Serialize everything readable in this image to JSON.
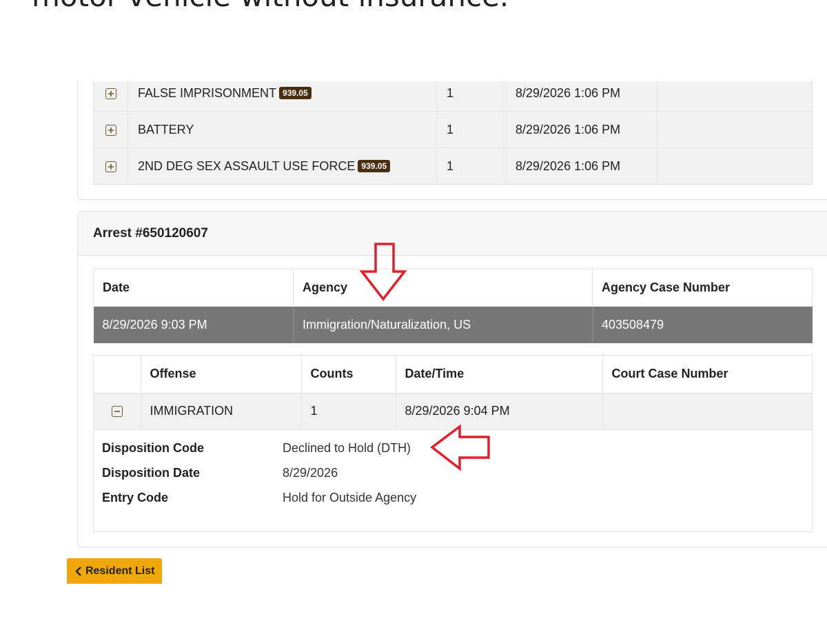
{
  "headline": "motor vehicle without insurance.",
  "previous_charges": [
    {
      "offense": "FALSE IMPRISONMENT",
      "badge": "939.05",
      "counts": "1",
      "datetime": "8/29/2026 1:06 PM",
      "court_case": ""
    },
    {
      "offense": "BATTERY",
      "badge": "",
      "counts": "1",
      "datetime": "8/29/2026 1:06 PM",
      "court_case": ""
    },
    {
      "offense": "2ND DEG SEX ASSAULT USE FORCE",
      "badge": "939.05",
      "counts": "1",
      "datetime": "8/29/2026 1:06 PM",
      "court_case": ""
    }
  ],
  "arrest": {
    "title": "Arrest #650120607",
    "headers": {
      "date": "Date",
      "agency": "Agency",
      "case_number": "Agency Case Number"
    },
    "row": {
      "date": "8/29/2026 9:03 PM",
      "agency": "Immigration/Naturalization, US",
      "case_number": "403508479"
    },
    "offense_headers": {
      "offense": "Offense",
      "counts": "Counts",
      "datetime": "Date/Time",
      "court_case": "Court Case Number"
    },
    "offense": {
      "name": "IMMIGRATION",
      "counts": "1",
      "datetime": "8/29/2026 9:04 PM",
      "court_case": ""
    },
    "details": [
      {
        "label": "Disposition Code",
        "value": "Declined to Hold (DTH)"
      },
      {
        "label": "Disposition Date",
        "value": "8/29/2026"
      },
      {
        "label": "Entry Code",
        "value": "Hold for Outside Agency"
      }
    ]
  },
  "back_button": {
    "label": "Resident List",
    "color": "#f0a70a"
  },
  "colors": {
    "highlight_row": "#777777",
    "annotation_arrow": "#e0212b",
    "badge": "#4a2e12"
  }
}
